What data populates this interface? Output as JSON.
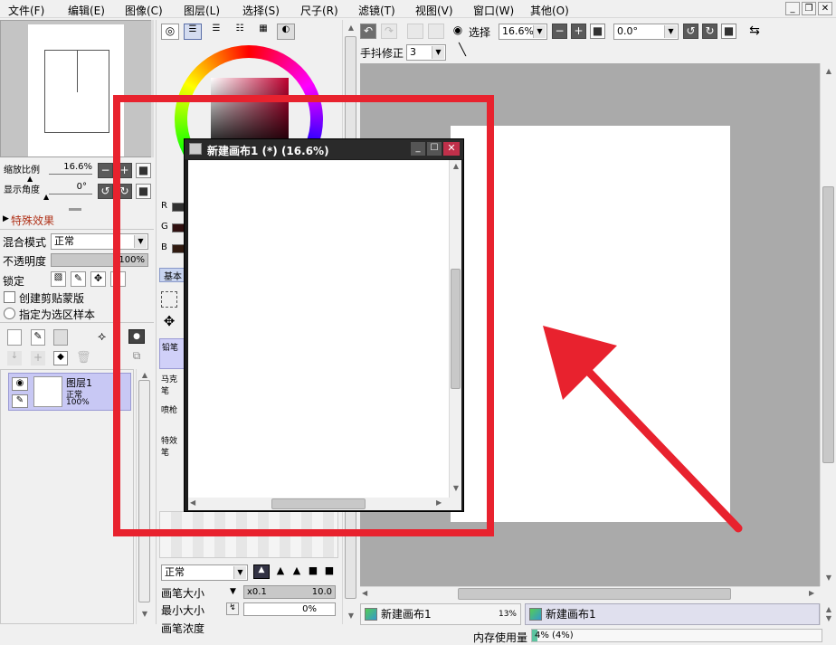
{
  "menu": [
    "文件(F)",
    "编辑(E)",
    "图像(C)",
    "图层(L)",
    "选择(S)",
    "尺子(R)",
    "滤镜(T)",
    "视图(V)",
    "窗口(W)",
    "其他(O)"
  ],
  "window_controls": [
    "_",
    "❐",
    "✕"
  ],
  "navigator": {
    "zoom_label": "缩放比例",
    "zoom_value": "16.6%",
    "angle_label": "显示角度",
    "angle_value": "0°"
  },
  "layer_panel": {
    "effects_label": "特殊效果",
    "blend_label": "混合模式",
    "blend_value": "正常",
    "opacity_label": "不透明度",
    "opacity_value": "100%",
    "lock_label": "锁定",
    "clip_label": "创建剪贴蒙版",
    "sample_label": "指定为选区样本",
    "layer": {
      "name": "图层1",
      "mode": "正常",
      "opacity": "100%"
    }
  },
  "color_panel": {
    "rgb_labels": [
      "R",
      "G",
      "B"
    ],
    "basic_tab": "基本"
  },
  "tools": {
    "items": [
      "铅笔",
      "马克笔",
      "喷枪",
      "特效笔"
    ]
  },
  "brush": {
    "mode": "正常",
    "size_label": "画笔大小",
    "size_mult": "x0.1",
    "size_value": "10.0",
    "min_size_label": "最小大小",
    "min_size_value": "0%",
    "density_label": "画笔浓度"
  },
  "toolbar": {
    "select_label": "选择",
    "zoom_value": "16.6%",
    "angle_value": "0.0°",
    "stabilizer_label": "手抖修正",
    "stabilizer_value": "3"
  },
  "sub_window": {
    "title": "新建画布1 (*) (16.6%)"
  },
  "tabs": [
    {
      "label": "新建画布1",
      "percent": "13%"
    },
    {
      "label": "新建画布1",
      "percent": ""
    }
  ],
  "status": {
    "memory_label": "内存使用量",
    "memory_value": "4% (4%)"
  },
  "colors": {
    "annotation": "#e8222e",
    "canvas_bg": "#aaaaaa"
  }
}
